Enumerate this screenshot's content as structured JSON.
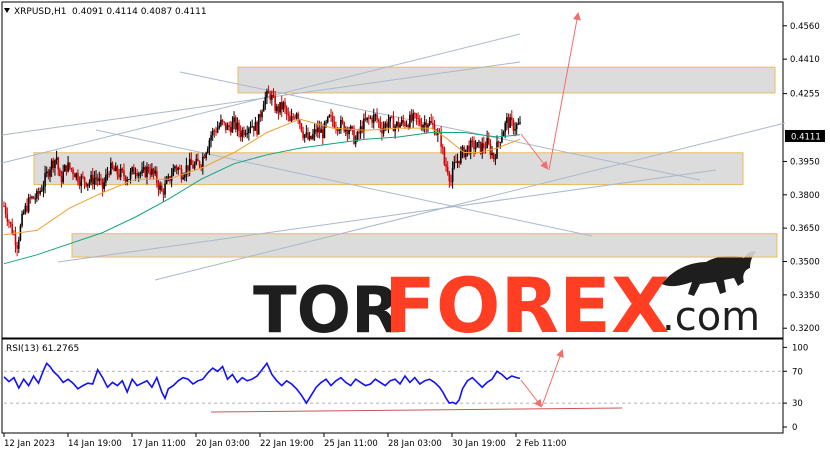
{
  "header": {
    "symbol_label": "XRPUSD,H1",
    "ohlc_label": "0.4091 0.4114 0.4087 0.4111"
  },
  "rsi_header": {
    "label": "RSI(13) 61.2765"
  },
  "watermark": {
    "brand_part1": "TOR",
    "brand_part2": "FOREX",
    "brand_suffix": ".com"
  },
  "colors": {
    "bull_candle": "#000000",
    "bear_candle": "#d40000",
    "ma_fast": "#f2a12e",
    "ma_slow": "#14a37f",
    "zone_fill": "#d9d9d9",
    "zone_border": "#e9b44c",
    "trendline": "#a9b9cc",
    "forecast_arrow": "#f26d6d",
    "rsi_line": "#1010ff",
    "rsi_support": "#cc5555",
    "price_tag_bg": "#000000"
  },
  "chart_data": [
    {
      "type": "candlestick",
      "title": "XRPUSD,H1",
      "ylim": [
        0.3165,
        0.4658
      ],
      "y_ticks": [
        "0.4560",
        "0.4410",
        "0.4255",
        "0.3950",
        "0.3800",
        "0.3650",
        "0.3500",
        "0.3350",
        "0.3200"
      ],
      "y_tick_values": [
        0.456,
        0.441,
        0.4255,
        0.395,
        0.38,
        0.365,
        0.35,
        0.335,
        0.32
      ],
      "x_ticks": [
        "12 Jan 2023",
        "14 Jan 19:00",
        "17 Jan 11:00",
        "20 Jan 03:00",
        "22 Jan 19:00",
        "25 Jan 11:00",
        "28 Jan 03:00",
        "30 Jan 19:00",
        "2 Feb 11:00"
      ],
      "current_price": "0.4111",
      "close_trace": [
        [
          0,
          0.375
        ],
        [
          4,
          0.366
        ],
        [
          8,
          0.358
        ],
        [
          12,
          0.372
        ],
        [
          16,
          0.378
        ],
        [
          20,
          0.379
        ],
        [
          24,
          0.385
        ],
        [
          28,
          0.393
        ],
        [
          32,
          0.397
        ],
        [
          34,
          0.386
        ],
        [
          38,
          0.393
        ],
        [
          42,
          0.391
        ],
        [
          46,
          0.387
        ],
        [
          52,
          0.386
        ],
        [
          56,
          0.388
        ],
        [
          60,
          0.383
        ],
        [
          64,
          0.392
        ],
        [
          68,
          0.39
        ],
        [
          72,
          0.389
        ],
        [
          76,
          0.388
        ],
        [
          80,
          0.392
        ],
        [
          84,
          0.389
        ],
        [
          88,
          0.392
        ],
        [
          92,
          0.388
        ],
        [
          96,
          0.381
        ],
        [
          100,
          0.386
        ],
        [
          104,
          0.393
        ],
        [
          108,
          0.39
        ],
        [
          112,
          0.393
        ],
        [
          116,
          0.393
        ],
        [
          120,
          0.395
        ],
        [
          126,
          0.407
        ],
        [
          132,
          0.412
        ],
        [
          136,
          0.41
        ],
        [
          140,
          0.412
        ],
        [
          144,
          0.408
        ],
        [
          150,
          0.412
        ],
        [
          154,
          0.41
        ],
        [
          158,
          0.423
        ],
        [
          162,
          0.425
        ],
        [
          166,
          0.418
        ],
        [
          170,
          0.42
        ],
        [
          174,
          0.412
        ],
        [
          178,
          0.418
        ],
        [
          182,
          0.408
        ],
        [
          186,
          0.404
        ],
        [
          190,
          0.409
        ],
        [
          194,
          0.408
        ],
        [
          198,
          0.414
        ],
        [
          202,
          0.412
        ],
        [
          206,
          0.411
        ],
        [
          210,
          0.41
        ],
        [
          214,
          0.404
        ],
        [
          218,
          0.411
        ],
        [
          222,
          0.414
        ],
        [
          226,
          0.415
        ],
        [
          230,
          0.41
        ],
        [
          234,
          0.413
        ],
        [
          238,
          0.411
        ],
        [
          242,
          0.412
        ],
        [
          246,
          0.413
        ],
        [
          250,
          0.414
        ],
        [
          254,
          0.412
        ],
        [
          258,
          0.413
        ],
        [
          262,
          0.41
        ],
        [
          266,
          0.404
        ],
        [
          268,
          0.394
        ],
        [
          270,
          0.392
        ],
        [
          272,
          0.386
        ],
        [
          274,
          0.393
        ],
        [
          278,
          0.398
        ],
        [
          282,
          0.401
        ],
        [
          286,
          0.402
        ],
        [
          290,
          0.401
        ],
        [
          294,
          0.403
        ],
        [
          298,
          0.397
        ],
        [
          302,
          0.406
        ],
        [
          306,
          0.413
        ],
        [
          310,
          0.411
        ],
        [
          314,
          0.411
        ]
      ],
      "ma_fast": [
        [
          0,
          0.362
        ],
        [
          20,
          0.364
        ],
        [
          40,
          0.374
        ],
        [
          60,
          0.381
        ],
        [
          80,
          0.387
        ],
        [
          100,
          0.387
        ],
        [
          120,
          0.392
        ],
        [
          140,
          0.399
        ],
        [
          160,
          0.408
        ],
        [
          180,
          0.414
        ],
        [
          200,
          0.41
        ],
        [
          220,
          0.409
        ],
        [
          240,
          0.41
        ],
        [
          260,
          0.41
        ],
        [
          270,
          0.405
        ],
        [
          280,
          0.399
        ],
        [
          290,
          0.399
        ],
        [
          300,
          0.401
        ],
        [
          314,
          0.405
        ]
      ],
      "ma_slow": [
        [
          0,
          0.349
        ],
        [
          20,
          0.353
        ],
        [
          40,
          0.358
        ],
        [
          60,
          0.363
        ],
        [
          80,
          0.37
        ],
        [
          100,
          0.378
        ],
        [
          120,
          0.387
        ],
        [
          140,
          0.394
        ],
        [
          160,
          0.398
        ],
        [
          180,
          0.401
        ],
        [
          200,
          0.403
        ],
        [
          220,
          0.405
        ],
        [
          240,
          0.406
        ],
        [
          260,
          0.408
        ],
        [
          280,
          0.408
        ],
        [
          300,
          0.406
        ],
        [
          314,
          0.407
        ]
      ],
      "zones": [
        {
          "from": 146,
          "to": 477,
          "high": 0.4374,
          "low": 0.4258
        },
        {
          "from": 20,
          "to": 457,
          "high": 0.3989,
          "low": 0.3846
        },
        {
          "from": 44,
          "to": 477,
          "high": 0.3625,
          "low": 0.352
        }
      ]
    },
    {
      "type": "line",
      "title": "RSI(13) 61.2765",
      "ylim": [
        -5,
        108
      ],
      "y_ticks": [
        "100",
        "70",
        "30",
        "0"
      ],
      "y_tick_values": [
        100,
        70,
        30,
        0
      ],
      "levels": [
        70,
        30
      ],
      "values": [
        [
          0,
          63
        ],
        [
          3,
          57
        ],
        [
          6,
          62
        ],
        [
          9,
          49
        ],
        [
          12,
          60
        ],
        [
          15,
          52
        ],
        [
          18,
          64
        ],
        [
          21,
          55
        ],
        [
          24,
          71
        ],
        [
          26,
          80
        ],
        [
          28,
          76
        ],
        [
          30,
          70
        ],
        [
          33,
          64
        ],
        [
          36,
          56
        ],
        [
          39,
          60
        ],
        [
          42,
          55
        ],
        [
          45,
          48
        ],
        [
          48,
          52
        ],
        [
          51,
          55
        ],
        [
          54,
          54
        ],
        [
          57,
          72
        ],
        [
          60,
          62
        ],
        [
          63,
          50
        ],
        [
          66,
          56
        ],
        [
          69,
          52
        ],
        [
          72,
          58
        ],
        [
          75,
          44
        ],
        [
          78,
          60
        ],
        [
          81,
          52
        ],
        [
          84,
          55
        ],
        [
          87,
          58
        ],
        [
          90,
          50
        ],
        [
          93,
          62
        ],
        [
          96,
          44
        ],
        [
          98,
          36
        ],
        [
          100,
          48
        ],
        [
          103,
          52
        ],
        [
          106,
          58
        ],
        [
          109,
          62
        ],
        [
          112,
          60
        ],
        [
          115,
          54
        ],
        [
          118,
          58
        ],
        [
          121,
          60
        ],
        [
          124,
          68
        ],
        [
          127,
          74
        ],
        [
          130,
          70
        ],
        [
          133,
          76
        ],
        [
          136,
          60
        ],
        [
          139,
          66
        ],
        [
          142,
          56
        ],
        [
          145,
          62
        ],
        [
          148,
          58
        ],
        [
          151,
          60
        ],
        [
          154,
          64
        ],
        [
          157,
          72
        ],
        [
          160,
          80
        ],
        [
          163,
          66
        ],
        [
          166,
          58
        ],
        [
          169,
          52
        ],
        [
          172,
          58
        ],
        [
          175,
          54
        ],
        [
          178,
          48
        ],
        [
          181,
          40
        ],
        [
          184,
          30
        ],
        [
          187,
          40
        ],
        [
          190,
          50
        ],
        [
          193,
          56
        ],
        [
          196,
          60
        ],
        [
          199,
          52
        ],
        [
          202,
          58
        ],
        [
          205,
          62
        ],
        [
          208,
          56
        ],
        [
          211,
          52
        ],
        [
          214,
          60
        ],
        [
          217,
          56
        ],
        [
          220,
          52
        ],
        [
          223,
          54
        ],
        [
          226,
          60
        ],
        [
          229,
          56
        ],
        [
          232,
          52
        ],
        [
          235,
          58
        ],
        [
          238,
          60
        ],
        [
          241,
          54
        ],
        [
          244,
          64
        ],
        [
          247,
          56
        ],
        [
          250,
          62
        ],
        [
          253,
          54
        ],
        [
          256,
          58
        ],
        [
          259,
          60
        ],
        [
          262,
          56
        ],
        [
          265,
          50
        ],
        [
          267,
          44
        ],
        [
          269,
          36
        ],
        [
          271,
          30
        ],
        [
          273,
          31
        ],
        [
          275,
          29
        ],
        [
          277,
          34
        ],
        [
          279,
          48
        ],
        [
          282,
          58
        ],
        [
          285,
          62
        ],
        [
          288,
          56
        ],
        [
          291,
          50
        ],
        [
          294,
          56
        ],
        [
          297,
          60
        ],
        [
          300,
          70
        ],
        [
          303,
          66
        ],
        [
          306,
          60
        ],
        [
          309,
          64
        ],
        [
          312,
          62
        ],
        [
          314,
          61
        ]
      ]
    }
  ]
}
